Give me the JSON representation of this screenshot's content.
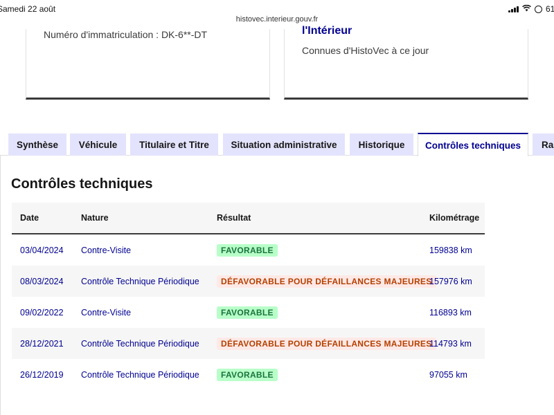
{
  "status_bar": {
    "time": "Samedi 22 août",
    "battery": "61"
  },
  "browser": {
    "url": "histovec.interieur.gouv.fr"
  },
  "cards": {
    "plate": "Numéro d'immatriculation : DK-6**-DT",
    "heading": "l'Intérieur",
    "subtitle": "Connues d'HistoVec à ce jour"
  },
  "tabs": [
    {
      "label": "Synthèse",
      "active": false
    },
    {
      "label": "Véhicule",
      "active": false
    },
    {
      "label": "Titulaire et Titre",
      "active": false
    },
    {
      "label": "Situation administrative",
      "active": false
    },
    {
      "label": "Historique",
      "active": false
    },
    {
      "label": "Contrôles techniques",
      "active": true
    },
    {
      "label": "Rap",
      "active": false
    }
  ],
  "section": {
    "title": "Contrôles techniques"
  },
  "table": {
    "headers": {
      "date": "Date",
      "nature": "Nature",
      "result": "Résultat",
      "km": "Kilométrage"
    },
    "rows": [
      {
        "date": "03/04/2024",
        "nature": "Contre-Visite",
        "result": "FAVORABLE",
        "status": "ok",
        "km": "159838 km"
      },
      {
        "date": "08/03/2024",
        "nature": "Contrôle Technique Périodique",
        "result": "DÉFAVORABLE POUR DÉFAILLANCES MAJEURES",
        "status": "ko",
        "km": "157976 km"
      },
      {
        "date": "09/02/2022",
        "nature": "Contre-Visite",
        "result": "FAVORABLE",
        "status": "ok",
        "km": "116893 km"
      },
      {
        "date": "28/12/2021",
        "nature": "Contrôle Technique Périodique",
        "result": "DÉFAVORABLE POUR DÉFAILLANCES MAJEURES",
        "status": "ko",
        "km": "114793 km"
      },
      {
        "date": "26/12/2019",
        "nature": "Contrôle Technique Périodique",
        "result": "FAVORABLE",
        "status": "ok",
        "km": "97055 km"
      }
    ]
  },
  "colors": {
    "accent": "#000091",
    "tab_bg": "#e3e3fd",
    "success_bg": "#b8fec9",
    "success_text": "#18753c",
    "error_bg": "#ffe9e6",
    "error_text": "#b34000"
  }
}
